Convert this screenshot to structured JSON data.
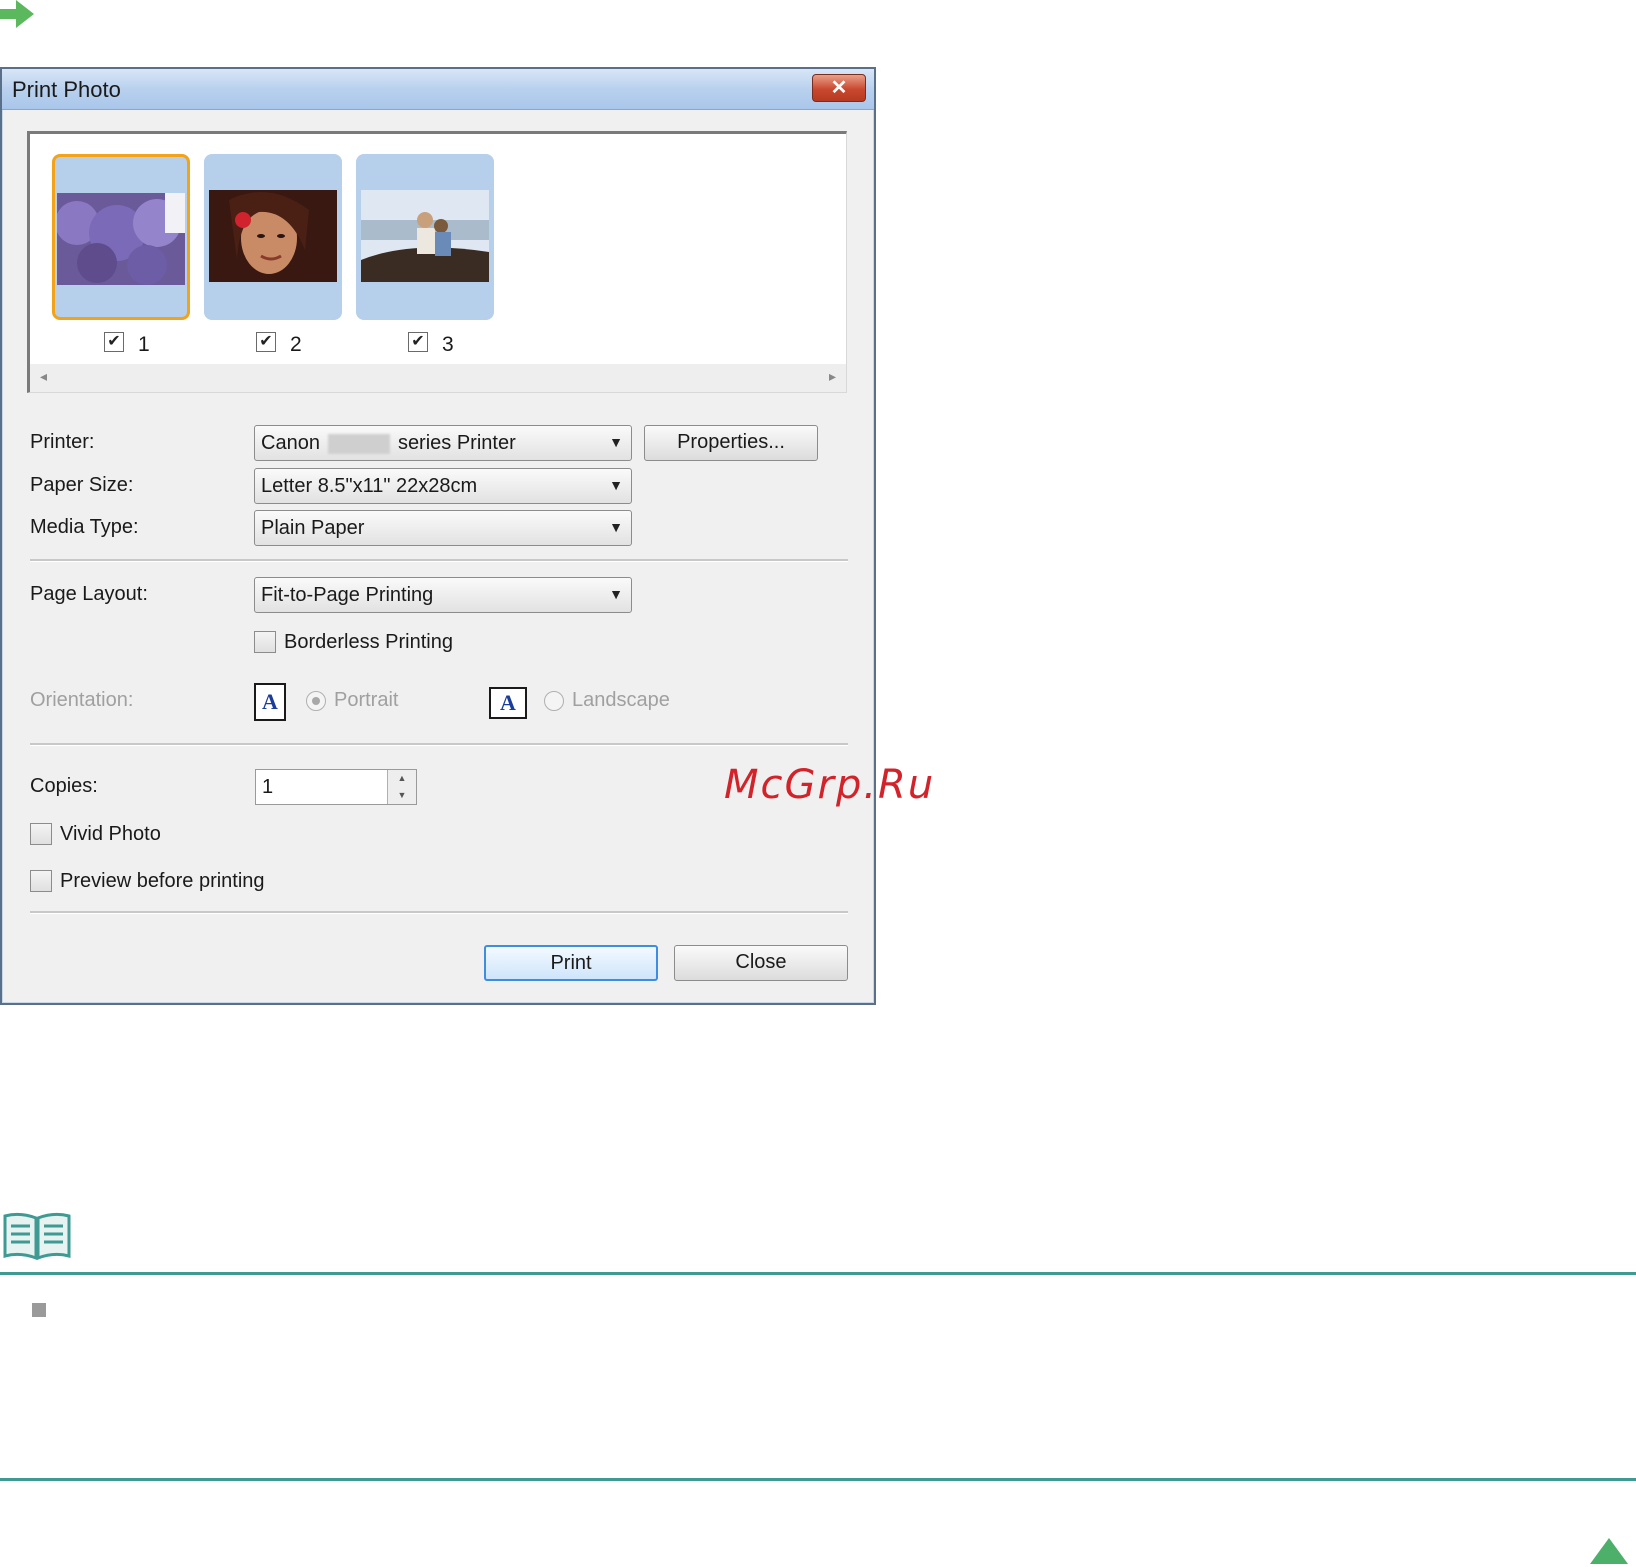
{
  "dialog": {
    "title": "Print Photo",
    "close_glyph": "✕"
  },
  "thumbnails": [
    {
      "label": "1",
      "checked": true,
      "selected": true
    },
    {
      "label": "2",
      "checked": true,
      "selected": false
    },
    {
      "label": "3",
      "checked": true,
      "selected": false
    }
  ],
  "form": {
    "printer_label": "Printer:",
    "printer_value_prefix": "Canon",
    "printer_value_suffix": "series Printer",
    "properties_button": "Properties...",
    "paper_size_label": "Paper Size:",
    "paper_size_value": "Letter 8.5\"x11\" 22x28cm",
    "media_type_label": "Media Type:",
    "media_type_value": "Plain Paper",
    "page_layout_label": "Page Layout:",
    "page_layout_value": "Fit-to-Page Printing",
    "borderless_label": "Borderless Printing",
    "orientation_label": "Orientation:",
    "portrait_label": "Portrait",
    "landscape_label": "Landscape",
    "orientation_glyph": "A",
    "copies_label": "Copies:",
    "copies_value": "1",
    "vivid_label": "Vivid Photo",
    "preview_label": "Preview before printing"
  },
  "buttons": {
    "print": "Print",
    "close": "Close"
  },
  "watermark": "McGrp.Ru",
  "colors": {
    "accent_teal": "#3e9a92",
    "selection_orange": "#f3a31a",
    "thumb_bg": "#b6cfea",
    "title_bar": "#b9d1ee",
    "arrow_green": "#5cb85c"
  }
}
